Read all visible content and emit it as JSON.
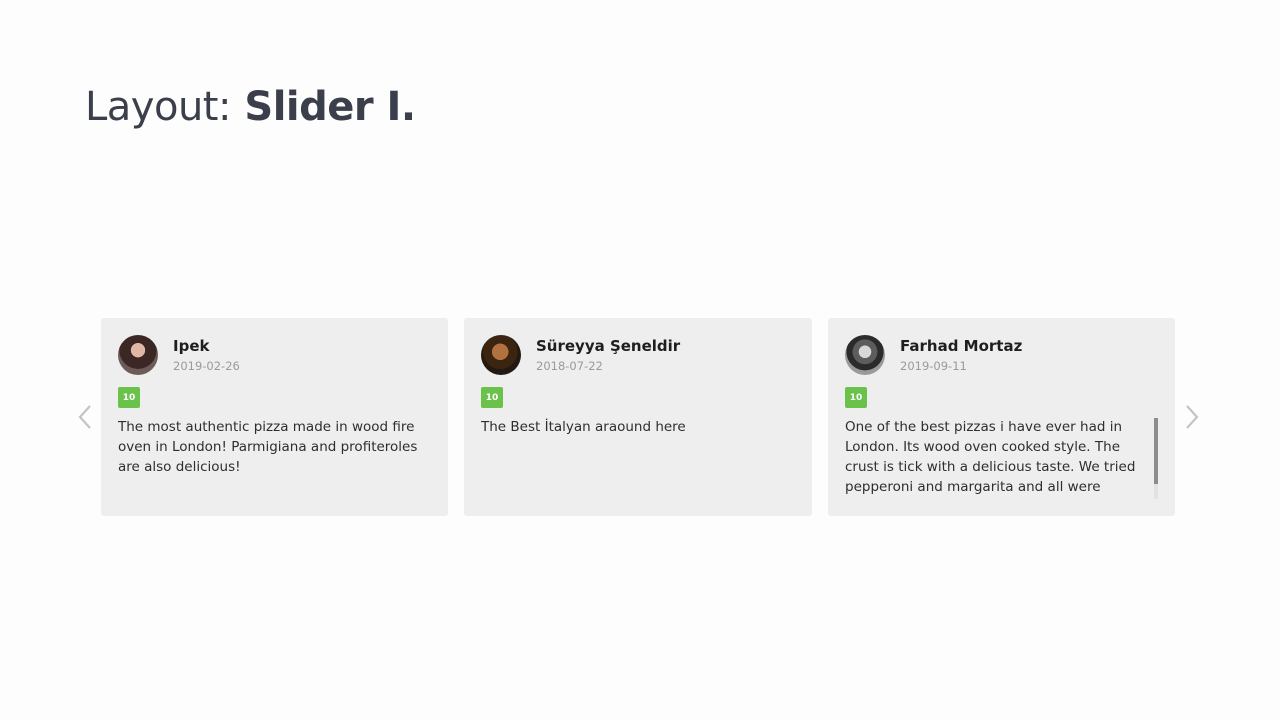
{
  "header": {
    "title_prefix": "Layout:",
    "title_emphasis": "Slider I."
  },
  "slider": {
    "prev_icon": "chevron-left-icon",
    "next_icon": "chevron-right-icon",
    "reviews": [
      {
        "name": "Ipek",
        "date": "2019-02-26",
        "rating": "10",
        "text": "The most authentic pizza made in wood fire oven in London! Parmigiana and profiteroles are also delicious!"
      },
      {
        "name": "Süreyya Şeneldir",
        "date": "2018-07-22",
        "rating": "10",
        "text": "The Best İtalyan araound here"
      },
      {
        "name": "Farhad Mortaz",
        "date": "2019-09-11",
        "rating": "10",
        "text": "One of the best pizzas i have ever had in London. Its wood oven cooked style. The crust is tick with a delicious taste. We tried pepperoni and margarita and all were"
      }
    ]
  },
  "colors": {
    "card_bg": "#eeeeee",
    "rating_badge": "#6ac24b",
    "title": "#3a3f4b"
  }
}
